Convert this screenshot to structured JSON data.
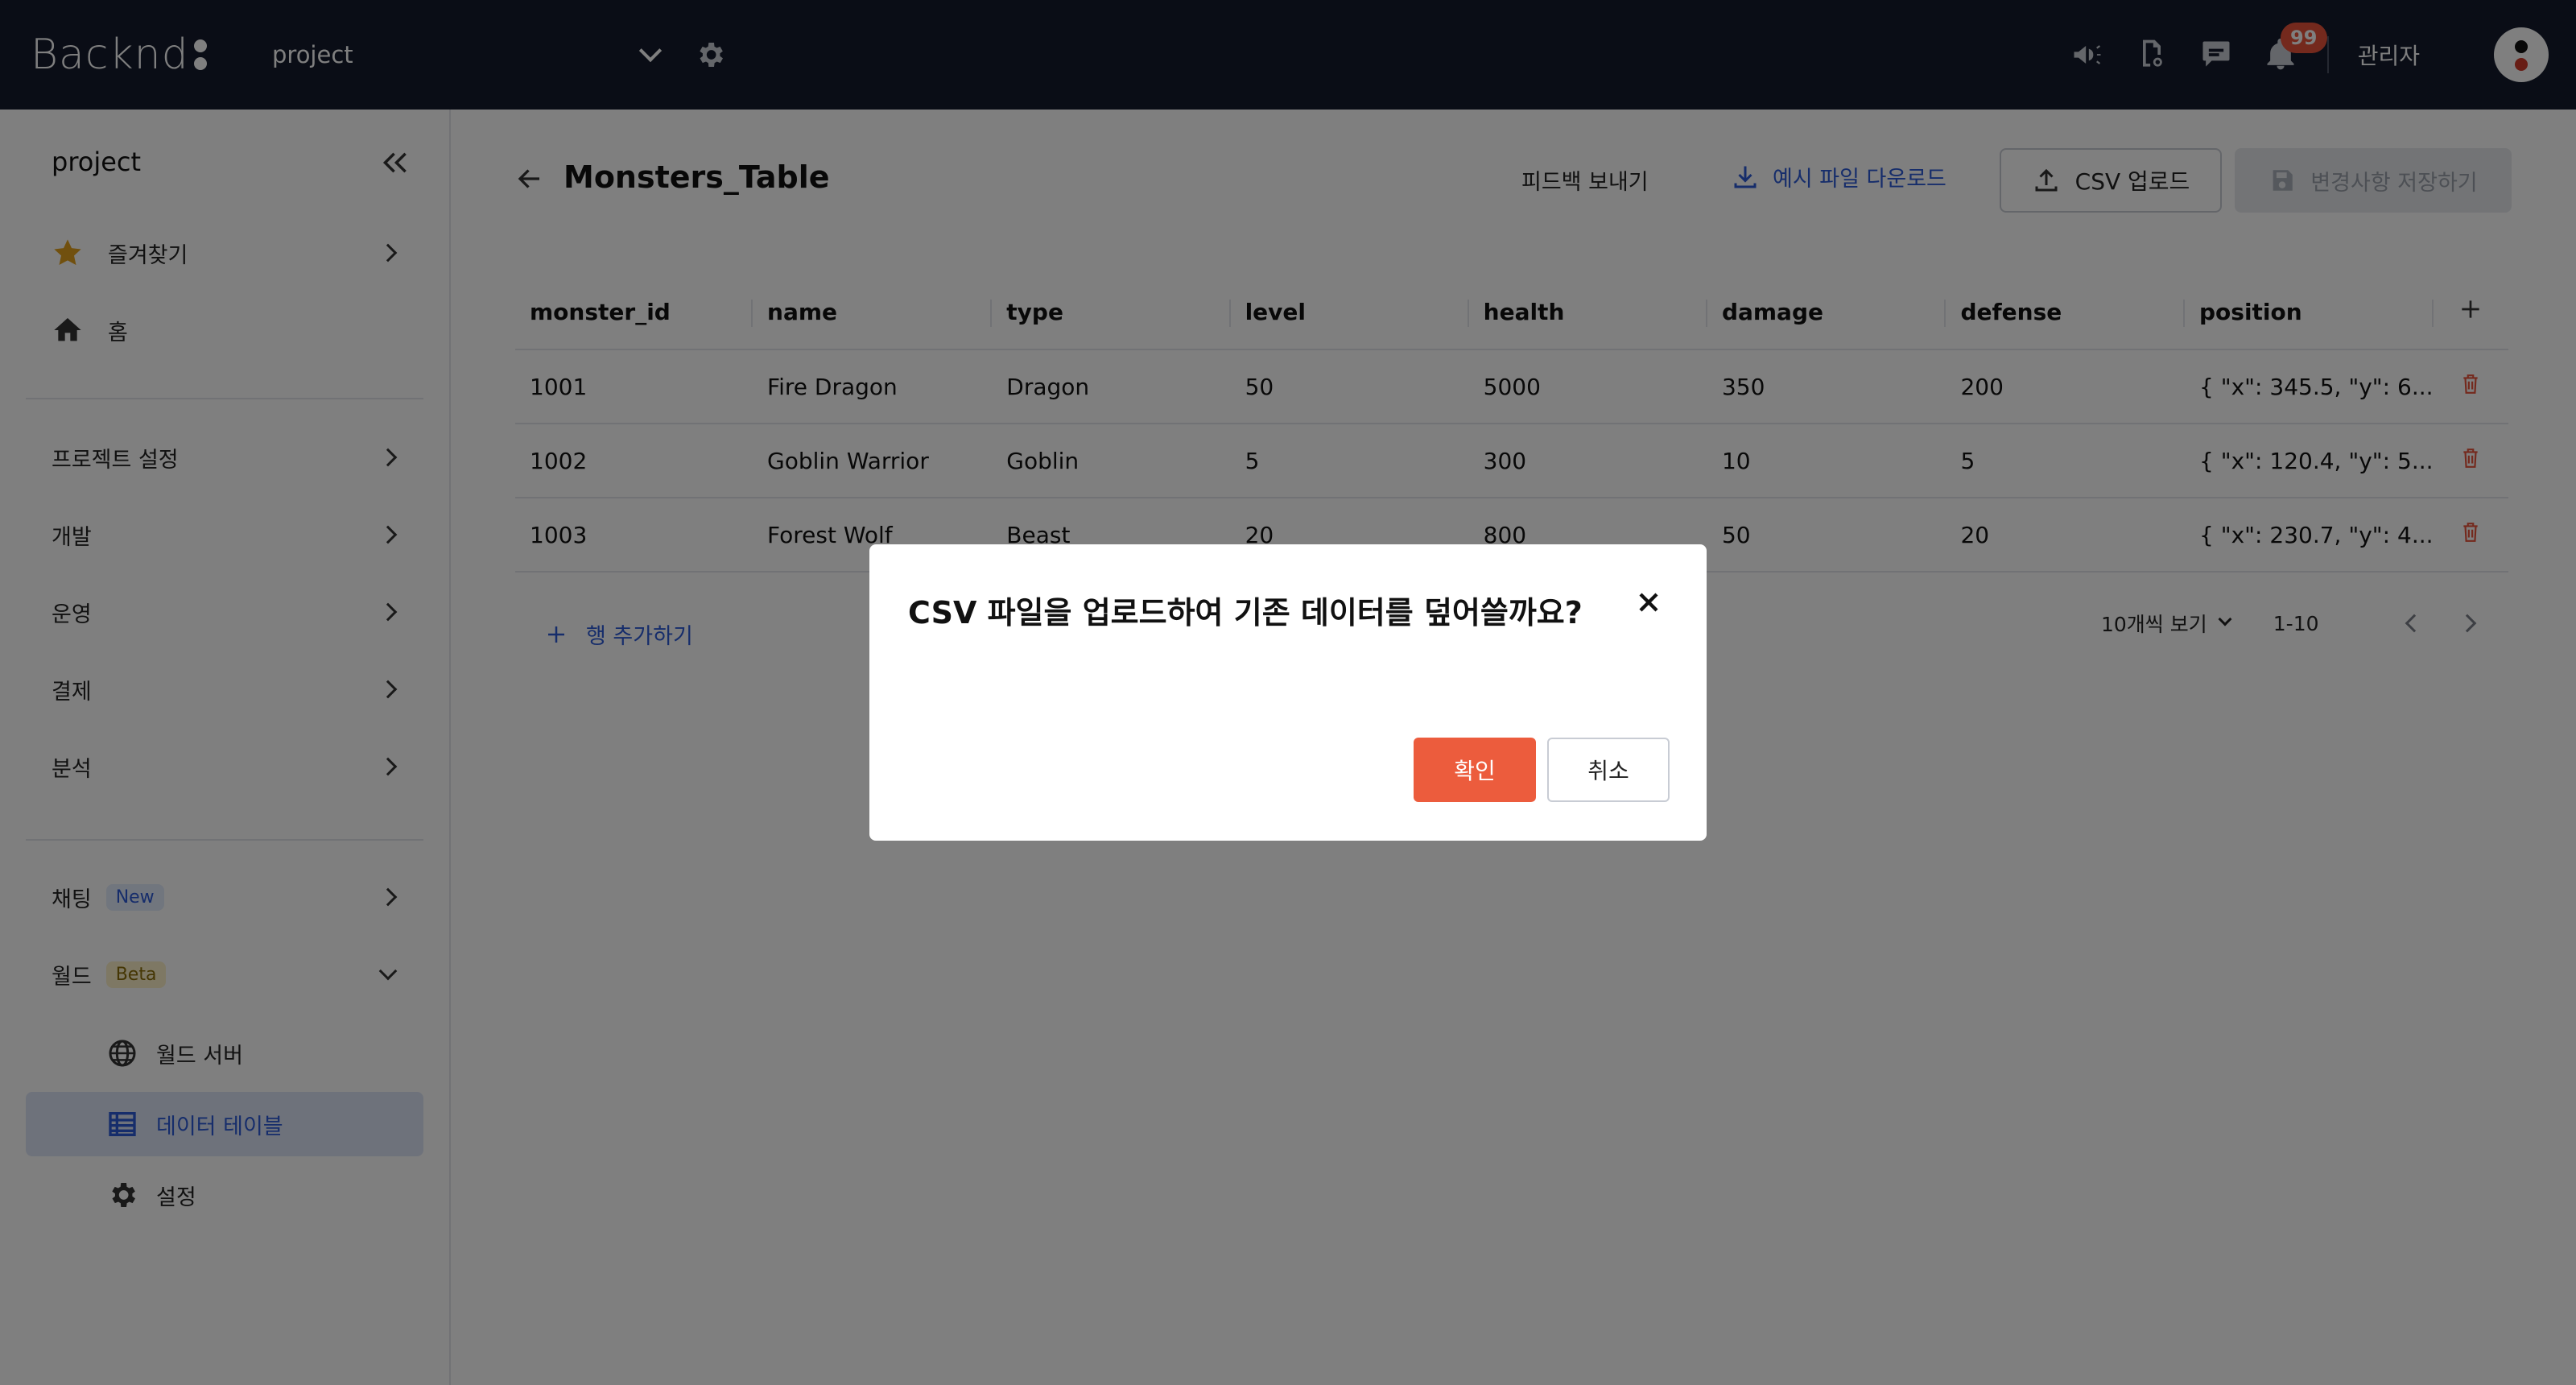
{
  "header": {
    "logo_text": "Backnd",
    "project_selector": "project",
    "notification_count": "99",
    "user_label": "관리자"
  },
  "sidebar": {
    "project_name": "project",
    "favorites": "즐겨찾기",
    "home": "홈",
    "groups": [
      "프로젝트 설정",
      "개발",
      "운영",
      "결제",
      "분석"
    ],
    "chat": {
      "label": "채팅",
      "tag": "New"
    },
    "world": {
      "label": "월드",
      "tag": "Beta"
    },
    "world_items": [
      "월드 서버",
      "데이터 테이블",
      "설정"
    ]
  },
  "page": {
    "title": "Monsters_Table",
    "feedback": "피드백 보내기",
    "download_sample": "예시 파일 다운로드",
    "csv_upload": "CSV 업로드",
    "save_changes": "변경사항 저장하기"
  },
  "table": {
    "columns": [
      "monster_id",
      "name",
      "type",
      "level",
      "health",
      "damage",
      "defense",
      "position"
    ],
    "rows": [
      [
        "1001",
        "Fire Dragon",
        "Dragon",
        "50",
        "5000",
        "350",
        "200",
        "{ \"x\": 345.5, \"y\": 6..."
      ],
      [
        "1002",
        "Goblin Warrior",
        "Goblin",
        "5",
        "300",
        "10",
        "5",
        "{ \"x\": 120.4, \"y\": 5..."
      ],
      [
        "1003",
        "Forest Wolf",
        "Beast",
        "20",
        "800",
        "50",
        "20",
        "{ \"x\": 230.7, \"y\": 4..."
      ]
    ],
    "add_row": "행 추가하기",
    "per_page": "10개씩 보기",
    "range": "1-10"
  },
  "modal": {
    "title": "CSV 파일을 업로드하여 기존 데이터를 덮어쓸까요?",
    "confirm": "확인",
    "cancel": "취소"
  },
  "colors": {
    "topbar": "#141a2c",
    "accent_blue": "#2d5bd6",
    "confirm_orange": "#ec5c3d",
    "badge_red": "#e8533a"
  }
}
